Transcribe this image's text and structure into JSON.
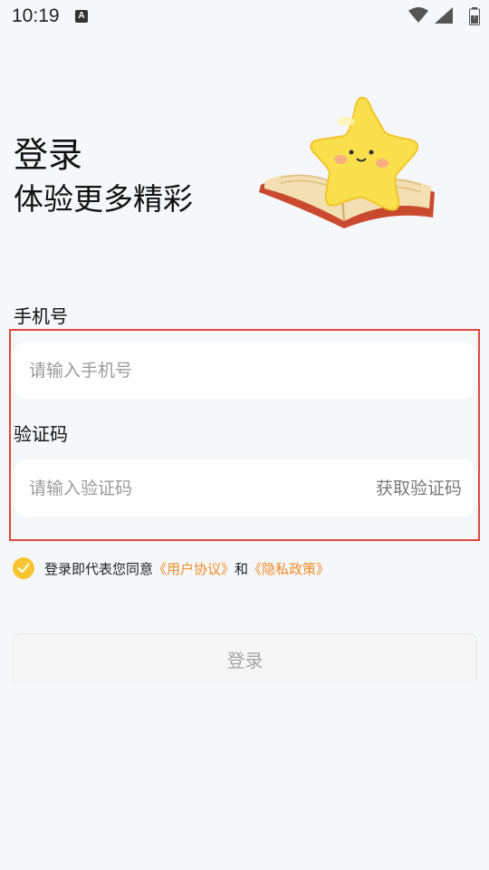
{
  "status_bar": {
    "time": "10:19",
    "notification_icon": "A"
  },
  "header": {
    "title": "登录",
    "subtitle": "体验更多精彩"
  },
  "mascot": {
    "icon": "star-on-book-illustration"
  },
  "phone": {
    "label": "手机号",
    "placeholder": "请输入手机号",
    "value": ""
  },
  "code": {
    "label": "验证码",
    "placeholder": "请输入验证码",
    "value": "",
    "get_code_label": "获取验证码"
  },
  "agreement": {
    "checked": true,
    "prefix": "登录即代表您同意",
    "user_agreement": "《用户协议》",
    "conjunction": "和",
    "privacy_policy": "《隐私政策》"
  },
  "login_button": {
    "label": "登录"
  },
  "colors": {
    "accent": "#f7c531",
    "link": "#f08a24",
    "highlight_border": "#e0473e",
    "background": "#f6f7fb"
  }
}
